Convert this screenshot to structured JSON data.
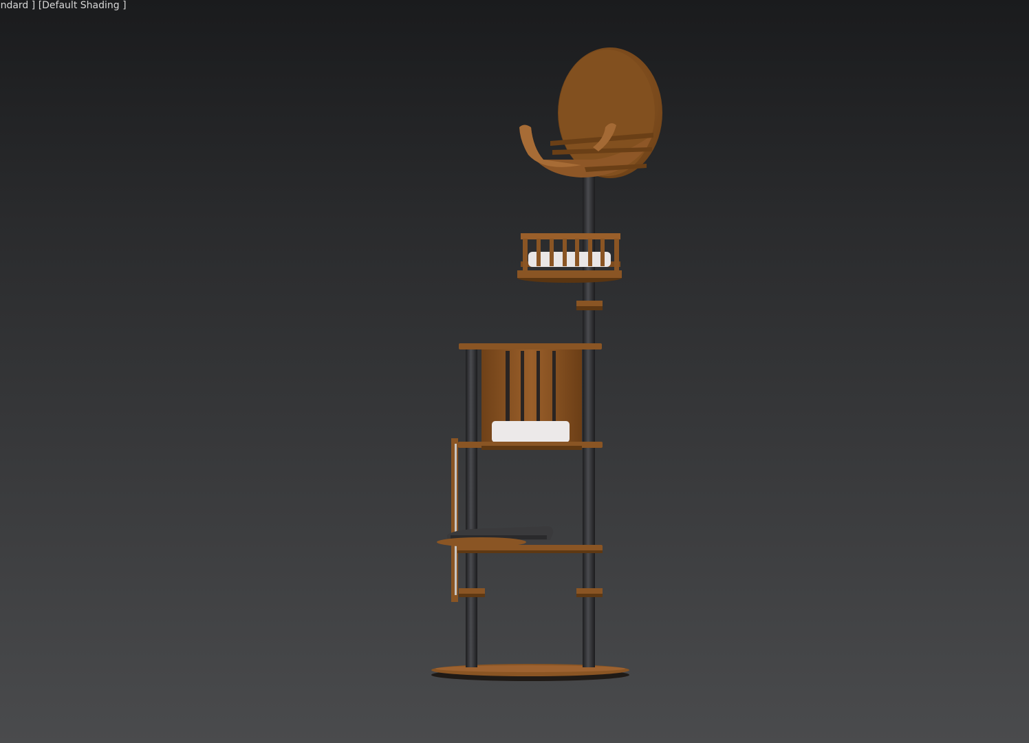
{
  "viewport": {
    "labels": {
      "view_mode": "Standard",
      "shading_mode": "Default Shading"
    },
    "visible_label_text": {
      "view_mode": "andard ]",
      "shading_mode": "[Default Shading ]"
    },
    "background_colors": {
      "top": "#1a1b1d",
      "bottom": "#4a4b4d"
    },
    "model": {
      "name": "cat-tree",
      "colors": {
        "wood": "#8a5524",
        "wood_dark": "#5e3813",
        "wood_light": "#a26a33",
        "pole": "#2a2a2c",
        "pole_highlight": "#55565a",
        "cushion": "#e9e6e6",
        "dark_bed": "#3a3a3c"
      }
    }
  }
}
